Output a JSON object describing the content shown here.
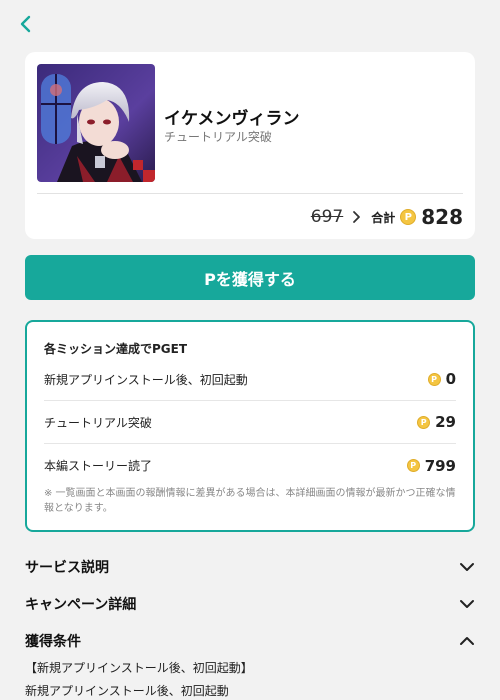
{
  "nav": {
    "back_icon": "chevron-left-icon"
  },
  "app": {
    "name": "イケメンヴィラン",
    "subtitle": "チュートリアル突破",
    "old_points": "697",
    "total_label": "合計",
    "coin_symbol": "P",
    "total_points": "828"
  },
  "cta": {
    "label": "Pを獲得する"
  },
  "missions": {
    "title": "各ミッション達成でPGET",
    "items": [
      {
        "name": "新規アプリインストール後、初回起動",
        "points": "0"
      },
      {
        "name": "チュートリアル突破",
        "points": "29"
      },
      {
        "name": "本編ストーリー読了",
        "points": "799"
      }
    ],
    "note": "※ 一覧画面と本画面の報酬情報に差異がある場合は、本詳細画面の情報が最新かつ正確な情報となります。"
  },
  "sections": [
    {
      "label": "サービス説明",
      "state": "collapsed"
    },
    {
      "label": "キャンペーン詳細",
      "state": "collapsed"
    },
    {
      "label": "獲得条件",
      "state": "expanded"
    }
  ],
  "conditions": {
    "heading": "【新規アプリインストール後、初回起動】",
    "text": "新規アプリインストール後、初回起動"
  },
  "colors": {
    "accent": "#17a89b",
    "coin": "#f4c542",
    "background": "#f2f2f2"
  }
}
